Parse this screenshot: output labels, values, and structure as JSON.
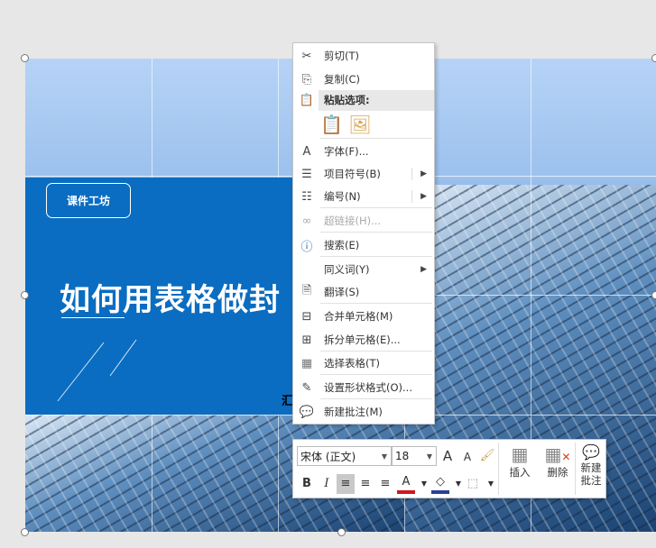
{
  "slide": {
    "badge": "课件工坊",
    "title": "如何用表格做封",
    "partial_text": "汇"
  },
  "context_menu": {
    "items": [
      {
        "icon": "scissors-icon",
        "label": "剪切(T)"
      },
      {
        "icon": "copy-icon",
        "label": "复制(C)"
      },
      {
        "icon": "paste-icon",
        "label": "粘贴选项:"
      },
      {
        "icon": "font-icon",
        "label": "字体(F)..."
      },
      {
        "icon": "bullets-icon",
        "label": "项目符号(B)"
      },
      {
        "icon": "numbering-icon",
        "label": "编号(N)"
      },
      {
        "icon": "hyperlink-icon",
        "label": "超链接(H)...",
        "disabled": true
      },
      {
        "icon": "search-icon",
        "label": "搜索(E)"
      },
      {
        "icon": "",
        "label": "同义词(Y)"
      },
      {
        "icon": "translate-icon",
        "label": "翻译(S)"
      },
      {
        "icon": "merge-cells-icon",
        "label": "合并单元格(M)"
      },
      {
        "icon": "split-cells-icon",
        "label": "拆分单元格(E)..."
      },
      {
        "icon": "select-table-icon",
        "label": "选择表格(T)"
      },
      {
        "icon": "format-shape-icon",
        "label": "设置形状格式(O)..."
      },
      {
        "icon": "new-comment-icon",
        "label": "新建批注(M)"
      }
    ]
  },
  "mini_toolbar": {
    "font": "宋体 (正文)",
    "size": "18",
    "grow": "A",
    "shrink": "A",
    "bold": "B",
    "italic": "I",
    "font_color_letter": "A",
    "insert": "插入",
    "delete": "删除",
    "new_comment_1": "新建",
    "new_comment_2": "批注",
    "font_color": "#d0191b",
    "fill_color": "#2a3f9b"
  }
}
